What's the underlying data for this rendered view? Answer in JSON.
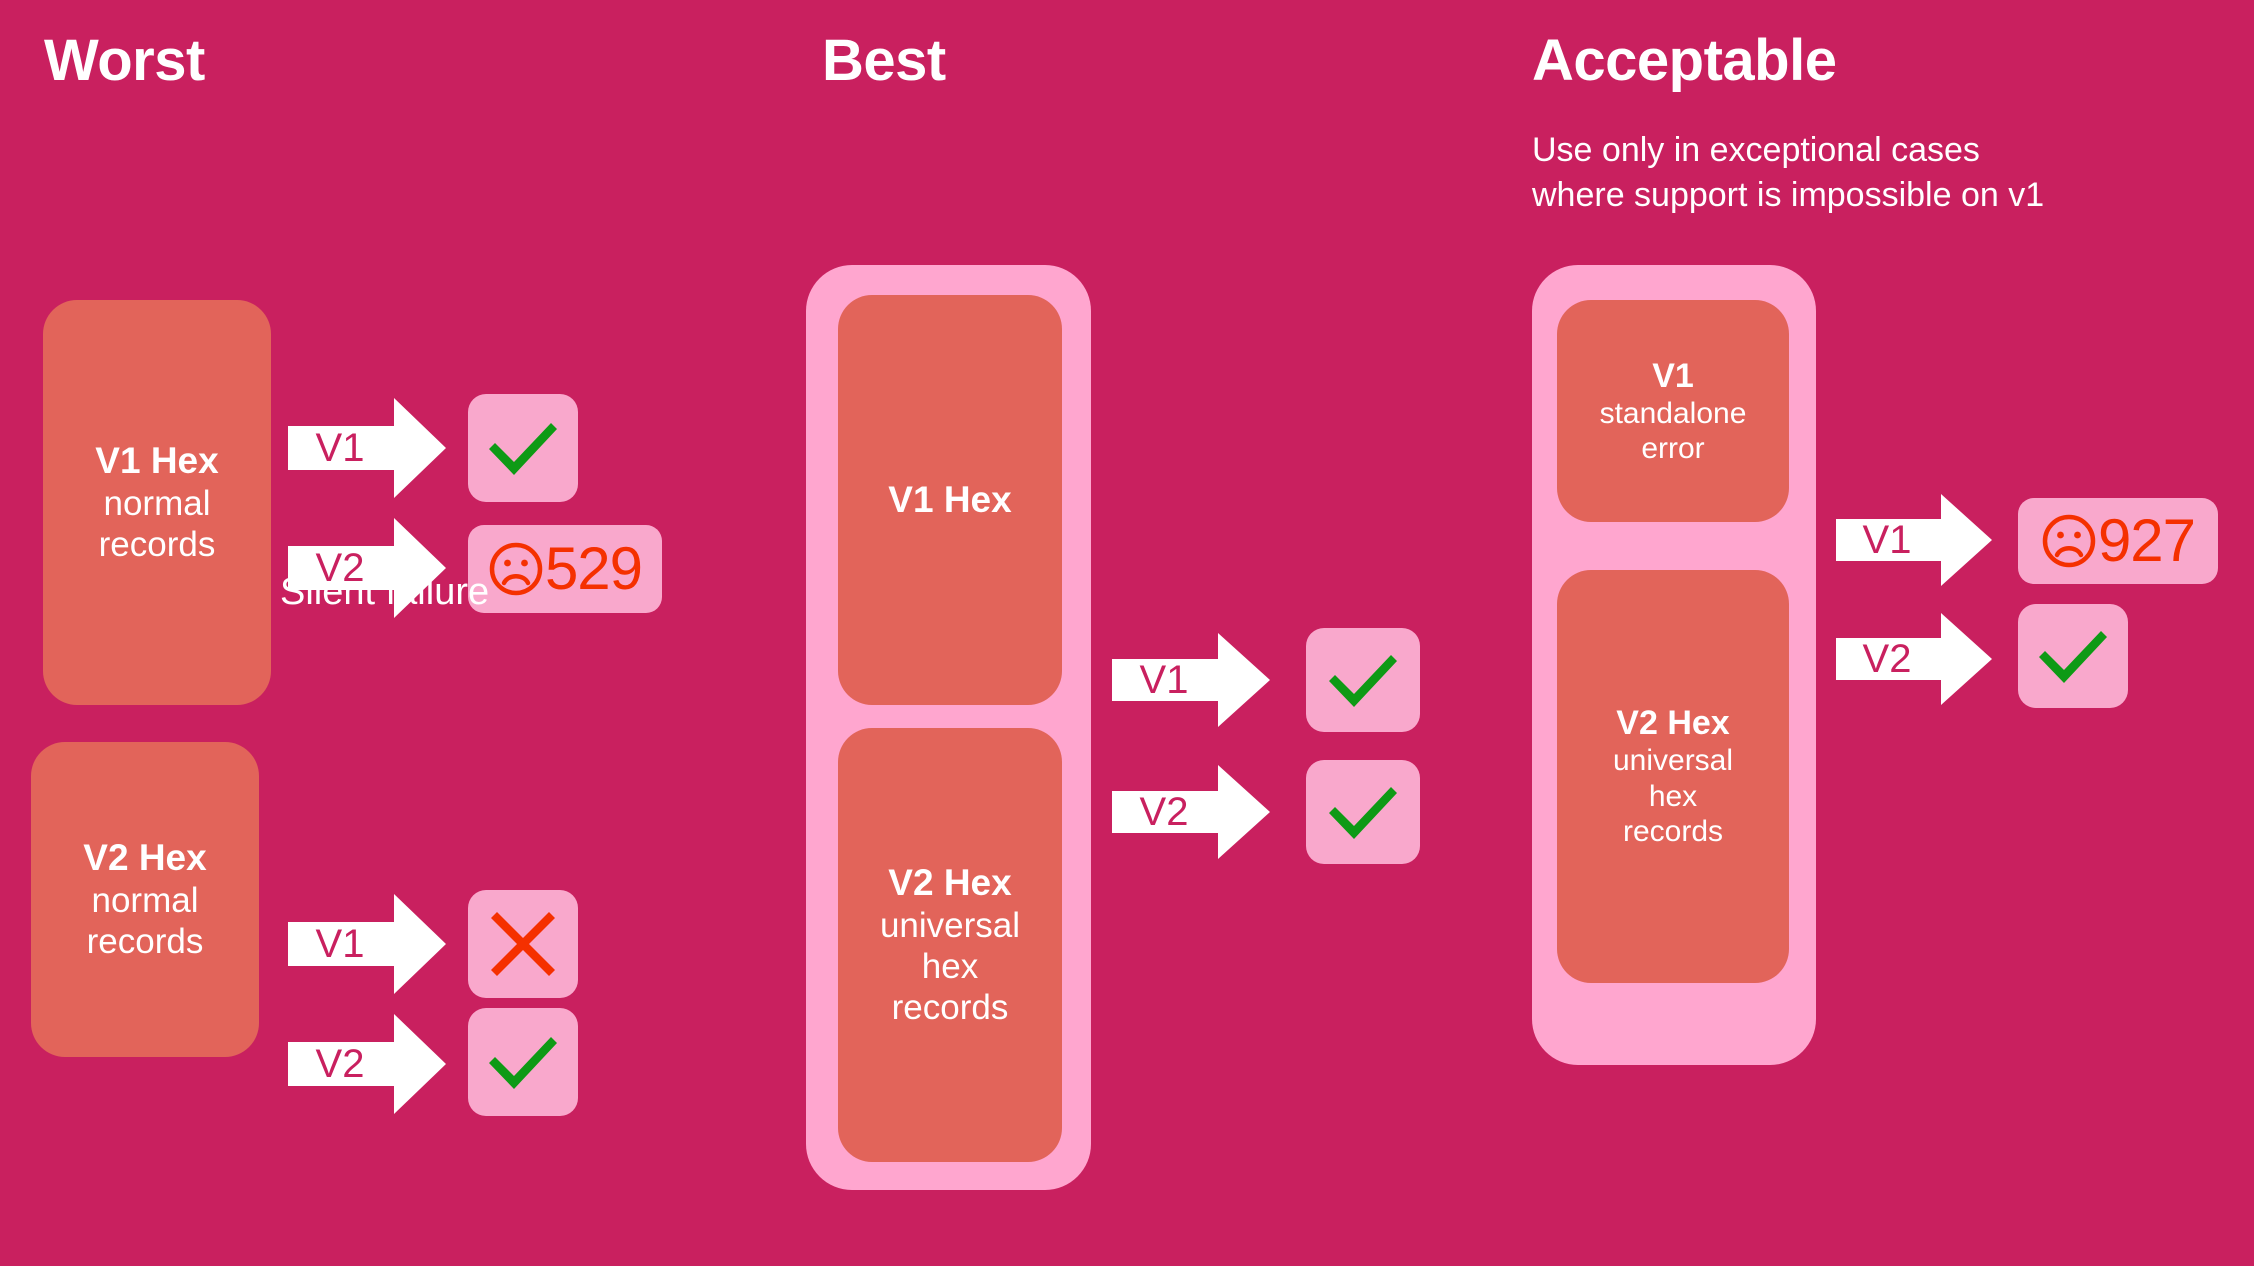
{
  "background_color": "#c9205f",
  "palette": {
    "background": "#c9205f",
    "source_box": "#e2645a",
    "group_wrap": "#ffa6cf",
    "result_tile": "#f9a8cc",
    "arrow": "#ffffff",
    "arrow_label": "#c9205f",
    "check_green": "#0e9a15",
    "error_red": "#f53000",
    "heading": "#ffffff"
  },
  "columns": [
    {
      "id": "worst",
      "title": "Worst",
      "subtitle": "",
      "rows": [
        {
          "id": "worst-v1",
          "source": {
            "title": "V1 Hex",
            "subtitle": "normal\nrecords"
          },
          "flows": [
            {
              "label": "V1",
              "result": "check",
              "result_text": ""
            },
            {
              "label": "V2",
              "result": "error",
              "result_text": "529"
            }
          ]
        },
        {
          "id": "worst-v2",
          "annotation": "Silent failure",
          "source": {
            "title": "V2 Hex",
            "subtitle": "normal\nrecords"
          },
          "flows": [
            {
              "label": "V1",
              "result": "cross",
              "result_text": ""
            },
            {
              "label": "V2",
              "result": "check",
              "result_text": ""
            }
          ]
        }
      ]
    },
    {
      "id": "best",
      "title": "Best",
      "subtitle": "",
      "grouped": true,
      "boxes": [
        {
          "title": "V1 Hex",
          "subtitle": ""
        },
        {
          "title": "V2 Hex",
          "subtitle": "universal\nhex\nrecords"
        }
      ],
      "flows": [
        {
          "label": "V1",
          "result": "check",
          "result_text": ""
        },
        {
          "label": "V2",
          "result": "check",
          "result_text": ""
        }
      ]
    },
    {
      "id": "acceptable",
      "title": "Acceptable",
      "subtitle": "Use only in exceptional cases\nwhere support is impossible on v1",
      "grouped": true,
      "boxes": [
        {
          "title": "V1",
          "subtitle": "standalone\nerror"
        },
        {
          "title": "V2 Hex",
          "subtitle": "universal\nhex\nrecords"
        }
      ],
      "flows": [
        {
          "label": "V1",
          "result": "error",
          "result_text": "927"
        },
        {
          "label": "V2",
          "result": "check",
          "result_text": ""
        }
      ]
    }
  ],
  "icons": {
    "check": "check-mark-icon",
    "cross": "cross-mark-icon",
    "frown": "frowning-face-icon"
  }
}
